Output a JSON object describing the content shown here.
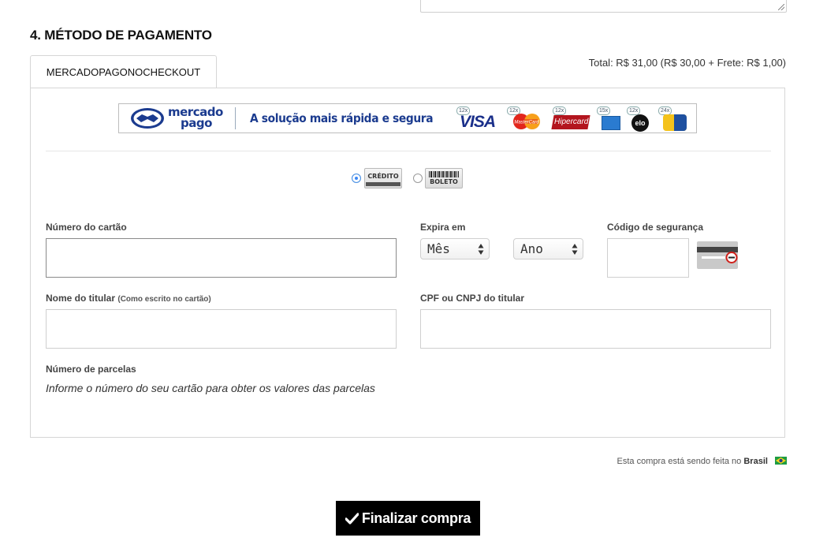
{
  "section": {
    "title": "4. MÉTODO DE PAGAMENTO",
    "order_total": "Total: R$ 31,00 (R$ 30,00 + Frete: R$ 1,00)"
  },
  "tabs": [
    {
      "label": "MERCADOPAGONOCHECKOUT",
      "active": true
    }
  ],
  "banner": {
    "brand_line1": "mercado",
    "brand_line2": "pago",
    "tagline": "A solução mais rápida e segura",
    "cards": [
      {
        "name": "VISA",
        "installments": "12x"
      },
      {
        "name": "MasterCard",
        "installments": "12x"
      },
      {
        "name": "Hipercard",
        "installments": "12x"
      },
      {
        "name": "American Express",
        "installments": "15x"
      },
      {
        "name": "elo",
        "installments": "12x"
      },
      {
        "name": "Diners",
        "installments": "24x"
      }
    ]
  },
  "payment_types": [
    {
      "label": "CRÉDITO",
      "selected": true
    },
    {
      "label": "BOLETO",
      "selected": false
    }
  ],
  "form": {
    "card_number_label": "Número do cartão",
    "card_number_value": "",
    "expiry_label": "Expira em",
    "month_selected": "Mês",
    "year_selected": "Ano",
    "cvv_label": "Código de segurança",
    "cvv_value": "",
    "holder_label": "Nome do titular",
    "holder_hint": "(Como escrito no cartão)",
    "holder_value": "",
    "cpf_label": "CPF ou CNPJ do titular",
    "cpf_value": "",
    "installments_label": "Número de parcelas",
    "installments_info": "Informe o número do seu cartão para obter os valores das parcelas"
  },
  "country": {
    "prefix": "Esta compra está sendo feita no",
    "name": "Brasil"
  },
  "finalize_button": "Finalizar compra",
  "colors": {
    "brand_blue": "#1b3b8f",
    "radio_selected": "#3b88f5",
    "button_bg": "#000000",
    "border": "#d6d6d6"
  }
}
